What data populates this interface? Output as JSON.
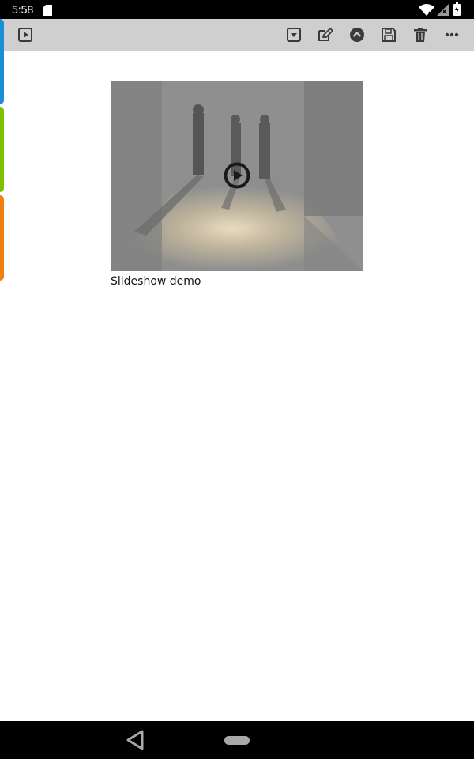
{
  "status_bar": {
    "time": "5:58",
    "icons": [
      "sd-card-icon",
      "wifi-icon",
      "signal-icon",
      "battery-icon"
    ]
  },
  "toolbar": {
    "left_buttons": [
      "slideshow-play-icon"
    ],
    "right_buttons": [
      "dropdown-icon",
      "edit-icon",
      "collapse-up-icon",
      "save-icon",
      "delete-icon",
      "more-icon"
    ]
  },
  "side_tabs": {
    "colors": [
      "#1b8fd6",
      "#7cc000",
      "#f07f10"
    ]
  },
  "media": {
    "caption": "Slideshow demo",
    "overlay_icon": "play-circle-icon"
  },
  "nav_bar": {
    "buttons": [
      "back-icon",
      "home-pill-icon"
    ]
  }
}
